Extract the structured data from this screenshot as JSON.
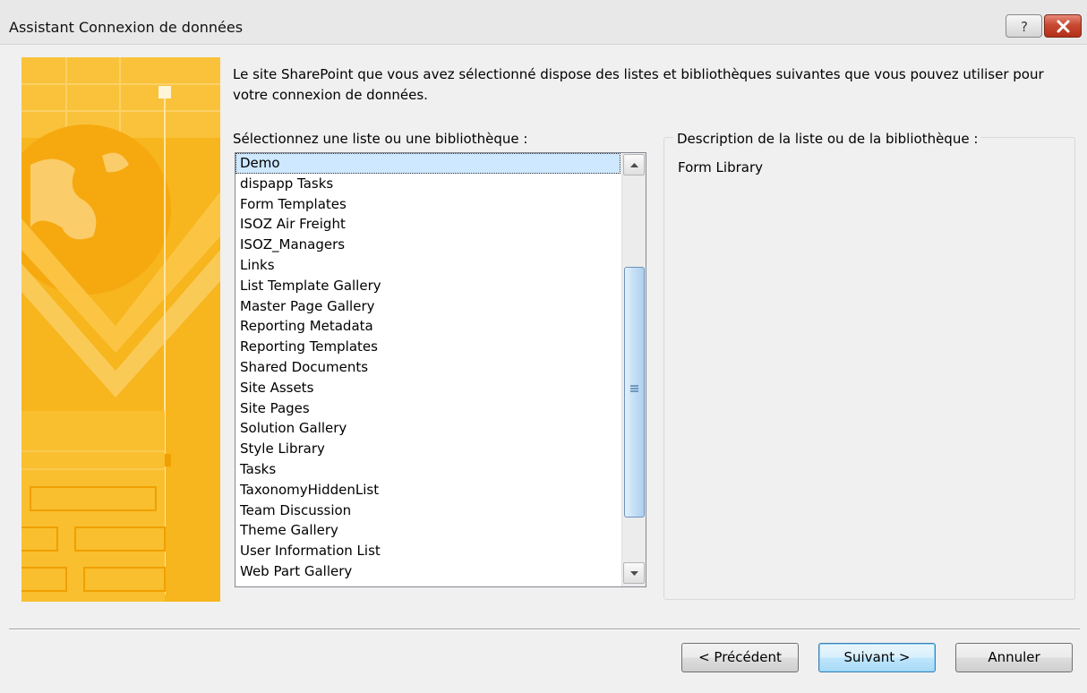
{
  "window": {
    "title": "Assistant Connexion de données",
    "help_symbol": "?",
    "close_symbol": "✕"
  },
  "intro_text": "Le site SharePoint que vous avez sélectionné dispose des listes et bibliothèques suivantes que vous pouvez utiliser pour votre connexion de données.",
  "list": {
    "label": "Sélectionnez une liste ou une bibliothèque :",
    "selected_index": 0,
    "items": [
      "Demo",
      "dispapp Tasks",
      "Form Templates",
      "ISOZ Air Freight",
      "ISOZ_Managers",
      "Links",
      "List Template Gallery",
      "Master Page Gallery",
      "Reporting Metadata",
      "Reporting Templates",
      "Shared Documents",
      "Site Assets",
      "Site Pages",
      "Solution Gallery",
      "Style Library",
      "Tasks",
      "TaxonomyHiddenList",
      "Team Discussion",
      "Theme Gallery",
      "User Information List",
      "Web Part Gallery"
    ]
  },
  "description": {
    "label": "Description de la liste ou de la bibliothèque :",
    "text": "Form Library"
  },
  "buttons": {
    "previous": "< Précédent",
    "next": "Suivant >",
    "cancel": "Annuler"
  },
  "colors": {
    "banner": "#f7b51e",
    "selection": "#cde8ff",
    "close_button": "#c74a33"
  }
}
